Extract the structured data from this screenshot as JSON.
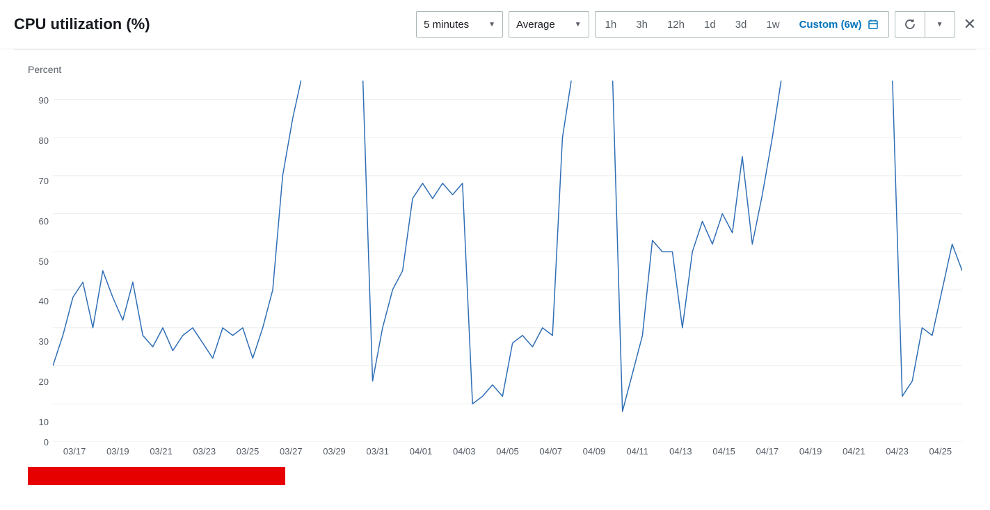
{
  "header": {
    "title": "CPU utilization (%)",
    "period_select": "5 minutes",
    "stat_select": "Average",
    "ranges": [
      "1h",
      "3h",
      "12h",
      "1d",
      "3d",
      "1w"
    ],
    "custom_label": "Custom (6w)"
  },
  "chart_data": {
    "type": "line",
    "ylabel": "Percent",
    "ylim": [
      0,
      95
    ],
    "y_ticks": [
      0,
      10,
      20,
      30,
      40,
      50,
      60,
      70,
      80,
      90
    ],
    "x_ticks": [
      "03/17",
      "03/19",
      "03/21",
      "03/23",
      "03/25",
      "03/27",
      "03/29",
      "03/31",
      "04/01",
      "04/03",
      "04/05",
      "04/07",
      "04/09",
      "04/11",
      "04/13",
      "04/15",
      "04/17",
      "04/19",
      "04/21",
      "04/23",
      "04/25"
    ],
    "series": [
      {
        "name": "CPU utilization",
        "color": "#2f6eb5",
        "x": [
          "03/16",
          "03/16.5",
          "03/17",
          "03/17.5",
          "03/18",
          "03/18.5",
          "03/19",
          "03/19.5",
          "03/20",
          "03/20.5",
          "03/21",
          "03/21.5",
          "03/22",
          "03/22.5",
          "03/23",
          "03/23.5",
          "03/24",
          "03/24.5",
          "03/25",
          "03/25.5",
          "03/26",
          "03/26.2",
          "03/26.5",
          "03/27",
          "03/27.5",
          "03/28",
          "03/28.5",
          "03/29",
          "03/29.5",
          "03/30",
          "03/30.5",
          "03/31",
          "03/31.2",
          "03/31.5",
          "04/01",
          "04/01.5",
          "04/02",
          "04/02.2",
          "04/02.5",
          "04/03",
          "04/03.5",
          "04/04",
          "04/04.1",
          "04/04.5",
          "04/05",
          "04/05.5",
          "04/06",
          "04/06.5",
          "04/07",
          "04/07.5",
          "04/08",
          "04/08.2",
          "04/08.5",
          "04/09",
          "04/09.5",
          "04/10",
          "04/10.5",
          "04/10.8",
          "04/11",
          "04/11.5",
          "04/12",
          "04/12.5",
          "04/13",
          "04/13.2",
          "04/13.5",
          "04/14",
          "04/14.5",
          "04/15",
          "04/15.5",
          "04/16",
          "04/16.2",
          "04/16.5",
          "04/17",
          "04/17.5",
          "04/18",
          "04/18.5",
          "04/19",
          "04/19.5",
          "04/20",
          "04/20.5",
          "04/21",
          "04/21.5",
          "04/22",
          "04/22.5",
          "04/23",
          "04/23.1",
          "04/23.5",
          "04/24",
          "04/24.5",
          "04/25",
          "04/25.5",
          "04/26"
        ],
        "values": [
          20,
          28,
          38,
          42,
          30,
          45,
          38,
          32,
          42,
          28,
          25,
          30,
          24,
          28,
          30,
          26,
          22,
          30,
          28,
          30,
          22,
          30,
          40,
          70,
          85,
          97,
          97,
          97,
          97,
          97,
          97,
          97,
          16,
          30,
          40,
          45,
          64,
          68,
          64,
          68,
          65,
          68,
          10,
          12,
          15,
          12,
          26,
          28,
          25,
          30,
          28,
          80,
          97,
          97,
          97,
          97,
          97,
          8,
          18,
          28,
          53,
          50,
          50,
          30,
          50,
          58,
          52,
          60,
          55,
          75,
          52,
          65,
          80,
          97,
          97,
          97,
          97,
          97,
          97,
          97,
          97,
          97,
          97,
          97,
          97,
          12,
          16,
          30,
          28,
          40,
          52,
          45
        ]
      }
    ]
  }
}
